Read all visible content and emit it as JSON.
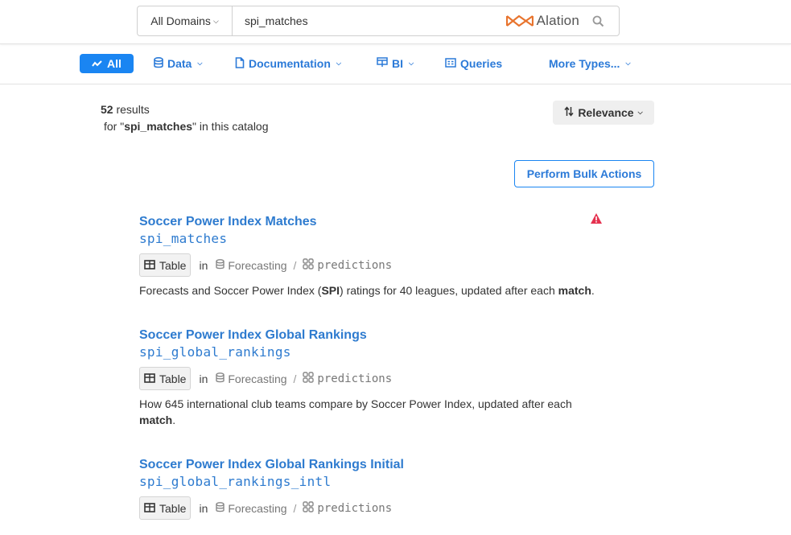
{
  "search": {
    "domain_label": "All Domains",
    "query": "spi_matches",
    "brand_name": "Alation",
    "brand_color": "#e8742e"
  },
  "types": [
    {
      "label": "All",
      "icon": "line-chart-icon",
      "active": true
    },
    {
      "label": "Data",
      "icon": "database-icon",
      "dropdown": true
    },
    {
      "label": "Documentation",
      "icon": "document-icon",
      "dropdown": true
    },
    {
      "label": "BI",
      "icon": "bi-report-icon",
      "dropdown": true
    },
    {
      "label": "Queries",
      "icon": "query-icon"
    },
    {
      "label": "More Types...",
      "dropdown": true
    }
  ],
  "results_summary": {
    "count": "52",
    "count_suffix": "results",
    "for_prefix": "for \"",
    "for_query": "spi_matches",
    "for_suffix": "\" in this catalog"
  },
  "sort": {
    "label": "Relevance"
  },
  "bulk_actions": {
    "label": "Perform Bulk Actions"
  },
  "results": [
    {
      "title": "Soccer Power Index Matches",
      "name": "spi_matches",
      "type_label": "Table",
      "in_label": "in",
      "source": "Forecasting",
      "schema": "predictions",
      "warning": true,
      "desc_parts": [
        "Forecasts and Soccer Power Index (",
        "SPI",
        ") ratings for 40 leagues, updated after each ",
        "match",
        "."
      ]
    },
    {
      "title": "Soccer Power Index Global Rankings",
      "name": "spi_global_rankings",
      "type_label": "Table",
      "in_label": "in",
      "source": "Forecasting",
      "schema": "predictions",
      "desc_parts": [
        "How 645 international club teams compare by Soccer Power Index, updated after each",
        "match",
        "."
      ]
    },
    {
      "title": "Soccer Power Index Global Rankings Initial",
      "name": "spi_global_rankings_intl",
      "type_label": "Table",
      "in_label": "in",
      "source": "Forecasting",
      "schema": "predictions"
    }
  ],
  "colors": {
    "link": "#2e7bcf",
    "accent": "#1a85f2",
    "warning": "#e5314f"
  }
}
